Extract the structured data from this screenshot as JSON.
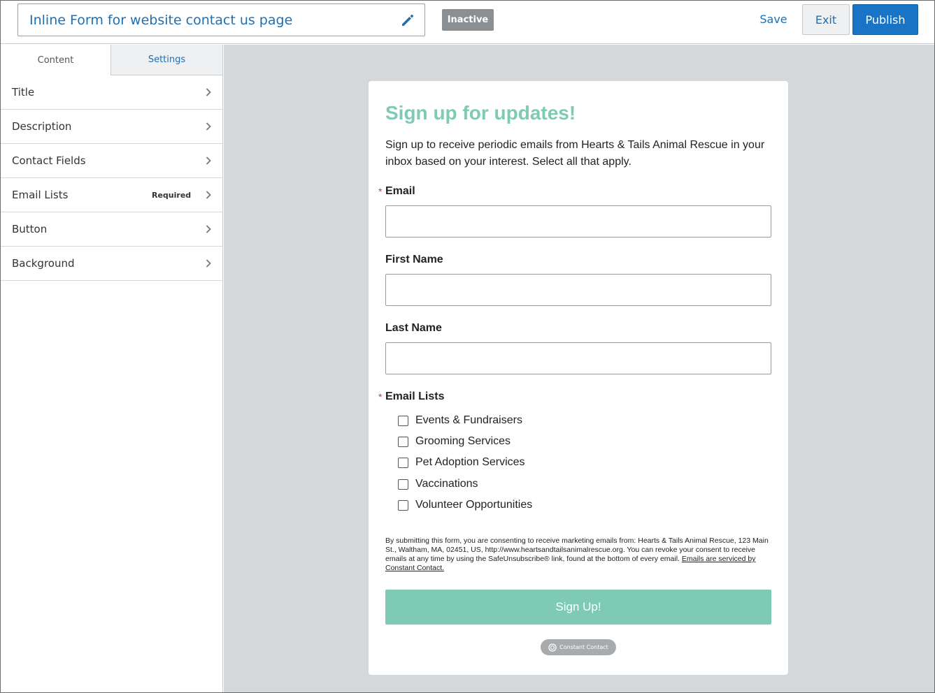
{
  "header": {
    "form_name": "Inline Form for website contact us page",
    "status": "Inactive",
    "save_label": "Save",
    "exit_label": "Exit",
    "publish_label": "Publish"
  },
  "sidebar": {
    "tabs": [
      {
        "label": "Content",
        "active": true
      },
      {
        "label": "Settings",
        "active": false
      }
    ],
    "items": [
      {
        "label": "Title",
        "tag": ""
      },
      {
        "label": "Description",
        "tag": ""
      },
      {
        "label": "Contact Fields",
        "tag": ""
      },
      {
        "label": "Email Lists",
        "tag": "Required"
      },
      {
        "label": "Button",
        "tag": ""
      },
      {
        "label": "Background",
        "tag": ""
      }
    ]
  },
  "form": {
    "title": "Sign up for updates!",
    "description": "Sign up to receive periodic emails from Hearts & Tails Animal Rescue in your inbox based on your interest. Select all that apply.",
    "required_marker": "*",
    "fields": [
      {
        "label": "Email",
        "required": true,
        "value": ""
      },
      {
        "label": "First Name",
        "required": false,
        "value": ""
      },
      {
        "label": "Last Name",
        "required": false,
        "value": ""
      }
    ],
    "email_lists_label": "Email Lists",
    "email_lists": [
      {
        "label": "Events & Fundraisers",
        "checked": false
      },
      {
        "label": "Grooming Services",
        "checked": false
      },
      {
        "label": "Pet Adoption Services",
        "checked": false
      },
      {
        "label": "Vaccinations",
        "checked": false
      },
      {
        "label": "Volunteer Opportunities",
        "checked": false
      }
    ],
    "consent_text": "By submitting this form, you are consenting to receive marketing emails from: Hearts & Tails Animal Rescue, 123 Main St., Waltham, MA, 02451, US, http://www.heartsandtailsanimalrescue.org. You can revoke your consent to receive emails at any time by using the SafeUnsubscribe® link, found at the bottom of every email.",
    "consent_link": "Emails are serviced by Constant Contact.",
    "submit_label": "Sign Up!",
    "badge_label": "Constant Contact"
  },
  "colors": {
    "accent": "#1a74c6",
    "title_green": "#7fcab5",
    "status_gray": "#8a8f93",
    "required_red": "#d0342c"
  }
}
